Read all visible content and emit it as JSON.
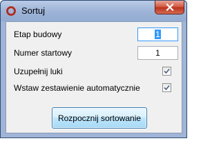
{
  "window": {
    "title": "Sortuj",
    "icon": "app-ring-icon",
    "close_icon": "close-x-icon",
    "accent_color": "#c0392b"
  },
  "form": {
    "fields": [
      {
        "label": "Etap budowy",
        "value": "1",
        "focused": true
      },
      {
        "label": "Numer startowy",
        "value": "1",
        "focused": false
      }
    ],
    "checkboxes": [
      {
        "label": "Uzupełnij luki",
        "checked": true
      },
      {
        "label": "Wstaw zestawienie automatycznie",
        "checked": true
      }
    ],
    "submit_label": "Rozpocznij sortowanie"
  }
}
